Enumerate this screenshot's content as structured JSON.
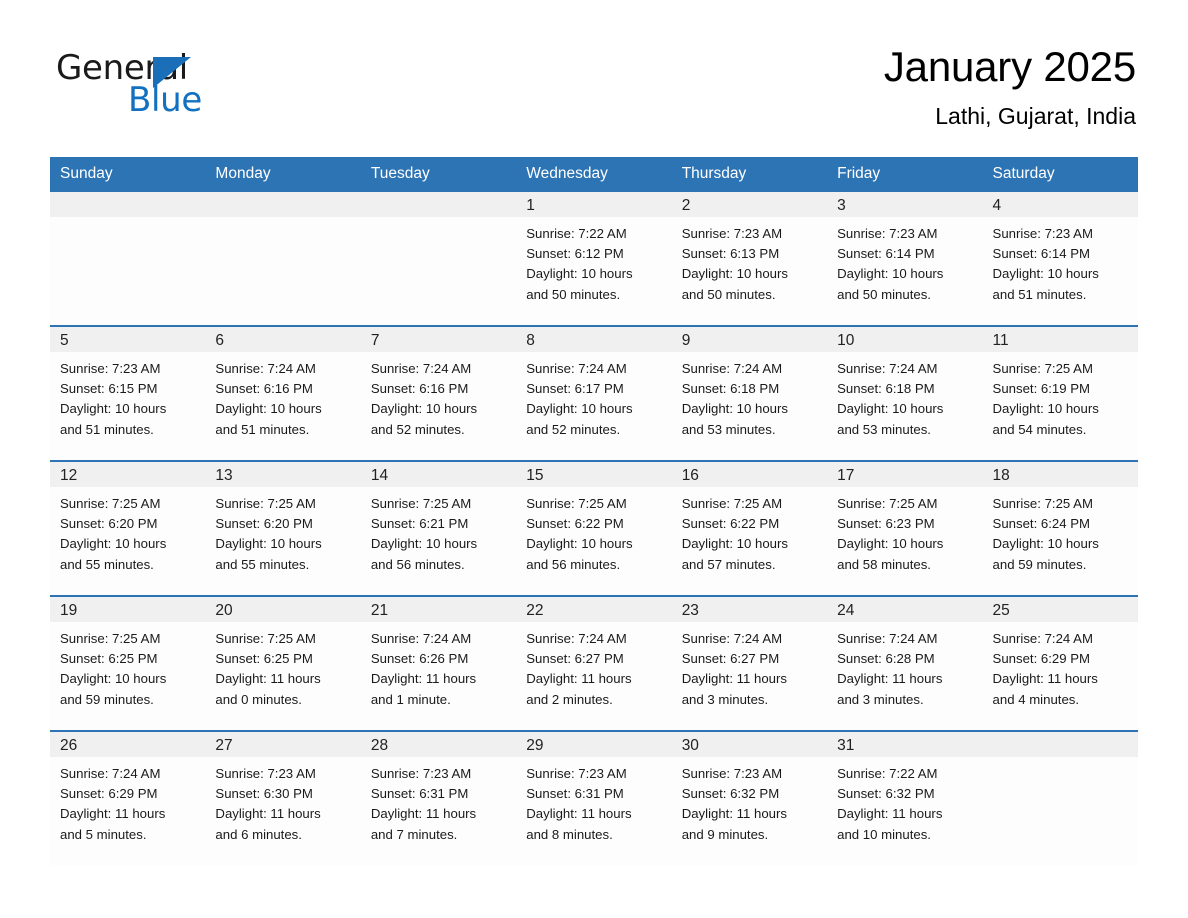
{
  "brand": {
    "name_top": "General",
    "name_bottom": "Blue",
    "accent_color": "#1170c0",
    "triangle_color": "#1a6fb8"
  },
  "header": {
    "title": "January 2025",
    "location": "Lathi, Gujarat, India"
  },
  "theme": {
    "header_blue": "#2d74b5",
    "row_divider_blue": "#2d74b5",
    "date_strip_gray": "#f0f0f0",
    "cell_background": "#fdfdfd"
  },
  "calendar": {
    "weekday_headers": [
      "Sunday",
      "Monday",
      "Tuesday",
      "Wednesday",
      "Thursday",
      "Friday",
      "Saturday"
    ],
    "weeks": [
      [
        {
          "day": "",
          "sunrise": "",
          "sunset": "",
          "daylight_line1": "",
          "daylight_line2": ""
        },
        {
          "day": "",
          "sunrise": "",
          "sunset": "",
          "daylight_line1": "",
          "daylight_line2": ""
        },
        {
          "day": "",
          "sunrise": "",
          "sunset": "",
          "daylight_line1": "",
          "daylight_line2": ""
        },
        {
          "day": "1",
          "sunrise": "Sunrise: 7:22 AM",
          "sunset": "Sunset: 6:12 PM",
          "daylight_line1": "Daylight: 10 hours",
          "daylight_line2": "and 50 minutes."
        },
        {
          "day": "2",
          "sunrise": "Sunrise: 7:23 AM",
          "sunset": "Sunset: 6:13 PM",
          "daylight_line1": "Daylight: 10 hours",
          "daylight_line2": "and 50 minutes."
        },
        {
          "day": "3",
          "sunrise": "Sunrise: 7:23 AM",
          "sunset": "Sunset: 6:14 PM",
          "daylight_line1": "Daylight: 10 hours",
          "daylight_line2": "and 50 minutes."
        },
        {
          "day": "4",
          "sunrise": "Sunrise: 7:23 AM",
          "sunset": "Sunset: 6:14 PM",
          "daylight_line1": "Daylight: 10 hours",
          "daylight_line2": "and 51 minutes."
        }
      ],
      [
        {
          "day": "5",
          "sunrise": "Sunrise: 7:23 AM",
          "sunset": "Sunset: 6:15 PM",
          "daylight_line1": "Daylight: 10 hours",
          "daylight_line2": "and 51 minutes."
        },
        {
          "day": "6",
          "sunrise": "Sunrise: 7:24 AM",
          "sunset": "Sunset: 6:16 PM",
          "daylight_line1": "Daylight: 10 hours",
          "daylight_line2": "and 51 minutes."
        },
        {
          "day": "7",
          "sunrise": "Sunrise: 7:24 AM",
          "sunset": "Sunset: 6:16 PM",
          "daylight_line1": "Daylight: 10 hours",
          "daylight_line2": "and 52 minutes."
        },
        {
          "day": "8",
          "sunrise": "Sunrise: 7:24 AM",
          "sunset": "Sunset: 6:17 PM",
          "daylight_line1": "Daylight: 10 hours",
          "daylight_line2": "and 52 minutes."
        },
        {
          "day": "9",
          "sunrise": "Sunrise: 7:24 AM",
          "sunset": "Sunset: 6:18 PM",
          "daylight_line1": "Daylight: 10 hours",
          "daylight_line2": "and 53 minutes."
        },
        {
          "day": "10",
          "sunrise": "Sunrise: 7:24 AM",
          "sunset": "Sunset: 6:18 PM",
          "daylight_line1": "Daylight: 10 hours",
          "daylight_line2": "and 53 minutes."
        },
        {
          "day": "11",
          "sunrise": "Sunrise: 7:25 AM",
          "sunset": "Sunset: 6:19 PM",
          "daylight_line1": "Daylight: 10 hours",
          "daylight_line2": "and 54 minutes."
        }
      ],
      [
        {
          "day": "12",
          "sunrise": "Sunrise: 7:25 AM",
          "sunset": "Sunset: 6:20 PM",
          "daylight_line1": "Daylight: 10 hours",
          "daylight_line2": "and 55 minutes."
        },
        {
          "day": "13",
          "sunrise": "Sunrise: 7:25 AM",
          "sunset": "Sunset: 6:20 PM",
          "daylight_line1": "Daylight: 10 hours",
          "daylight_line2": "and 55 minutes."
        },
        {
          "day": "14",
          "sunrise": "Sunrise: 7:25 AM",
          "sunset": "Sunset: 6:21 PM",
          "daylight_line1": "Daylight: 10 hours",
          "daylight_line2": "and 56 minutes."
        },
        {
          "day": "15",
          "sunrise": "Sunrise: 7:25 AM",
          "sunset": "Sunset: 6:22 PM",
          "daylight_line1": "Daylight: 10 hours",
          "daylight_line2": "and 56 minutes."
        },
        {
          "day": "16",
          "sunrise": "Sunrise: 7:25 AM",
          "sunset": "Sunset: 6:22 PM",
          "daylight_line1": "Daylight: 10 hours",
          "daylight_line2": "and 57 minutes."
        },
        {
          "day": "17",
          "sunrise": "Sunrise: 7:25 AM",
          "sunset": "Sunset: 6:23 PM",
          "daylight_line1": "Daylight: 10 hours",
          "daylight_line2": "and 58 minutes."
        },
        {
          "day": "18",
          "sunrise": "Sunrise: 7:25 AM",
          "sunset": "Sunset: 6:24 PM",
          "daylight_line1": "Daylight: 10 hours",
          "daylight_line2": "and 59 minutes."
        }
      ],
      [
        {
          "day": "19",
          "sunrise": "Sunrise: 7:25 AM",
          "sunset": "Sunset: 6:25 PM",
          "daylight_line1": "Daylight: 10 hours",
          "daylight_line2": "and 59 minutes."
        },
        {
          "day": "20",
          "sunrise": "Sunrise: 7:25 AM",
          "sunset": "Sunset: 6:25 PM",
          "daylight_line1": "Daylight: 11 hours",
          "daylight_line2": "and 0 minutes."
        },
        {
          "day": "21",
          "sunrise": "Sunrise: 7:24 AM",
          "sunset": "Sunset: 6:26 PM",
          "daylight_line1": "Daylight: 11 hours",
          "daylight_line2": "and 1 minute."
        },
        {
          "day": "22",
          "sunrise": "Sunrise: 7:24 AM",
          "sunset": "Sunset: 6:27 PM",
          "daylight_line1": "Daylight: 11 hours",
          "daylight_line2": "and 2 minutes."
        },
        {
          "day": "23",
          "sunrise": "Sunrise: 7:24 AM",
          "sunset": "Sunset: 6:27 PM",
          "daylight_line1": "Daylight: 11 hours",
          "daylight_line2": "and 3 minutes."
        },
        {
          "day": "24",
          "sunrise": "Sunrise: 7:24 AM",
          "sunset": "Sunset: 6:28 PM",
          "daylight_line1": "Daylight: 11 hours",
          "daylight_line2": "and 3 minutes."
        },
        {
          "day": "25",
          "sunrise": "Sunrise: 7:24 AM",
          "sunset": "Sunset: 6:29 PM",
          "daylight_line1": "Daylight: 11 hours",
          "daylight_line2": "and 4 minutes."
        }
      ],
      [
        {
          "day": "26",
          "sunrise": "Sunrise: 7:24 AM",
          "sunset": "Sunset: 6:29 PM",
          "daylight_line1": "Daylight: 11 hours",
          "daylight_line2": "and 5 minutes."
        },
        {
          "day": "27",
          "sunrise": "Sunrise: 7:23 AM",
          "sunset": "Sunset: 6:30 PM",
          "daylight_line1": "Daylight: 11 hours",
          "daylight_line2": "and 6 minutes."
        },
        {
          "day": "28",
          "sunrise": "Sunrise: 7:23 AM",
          "sunset": "Sunset: 6:31 PM",
          "daylight_line1": "Daylight: 11 hours",
          "daylight_line2": "and 7 minutes."
        },
        {
          "day": "29",
          "sunrise": "Sunrise: 7:23 AM",
          "sunset": "Sunset: 6:31 PM",
          "daylight_line1": "Daylight: 11 hours",
          "daylight_line2": "and 8 minutes."
        },
        {
          "day": "30",
          "sunrise": "Sunrise: 7:23 AM",
          "sunset": "Sunset: 6:32 PM",
          "daylight_line1": "Daylight: 11 hours",
          "daylight_line2": "and 9 minutes."
        },
        {
          "day": "31",
          "sunrise": "Sunrise: 7:22 AM",
          "sunset": "Sunset: 6:32 PM",
          "daylight_line1": "Daylight: 11 hours",
          "daylight_line2": "and 10 minutes."
        },
        {
          "day": "",
          "sunrise": "",
          "sunset": "",
          "daylight_line1": "",
          "daylight_line2": ""
        }
      ]
    ]
  }
}
